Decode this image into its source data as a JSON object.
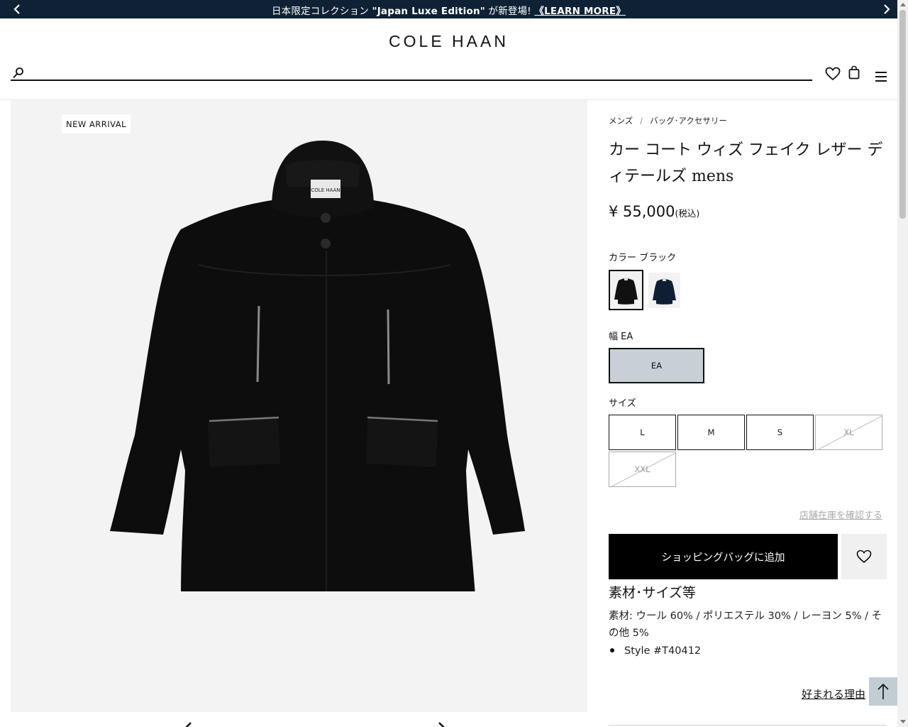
{
  "promo": {
    "text_prefix": "日本限定コレクション ",
    "text_highlight": "\"Japan Luxe Edition\"",
    "text_suffix": " が新登場! ",
    "link_label": "《LEARN MORE》"
  },
  "header": {
    "logo": "COLE HAAN",
    "search_placeholder": "",
    "icons": [
      "search-icon",
      "heart-icon",
      "bag-icon",
      "menu-icon"
    ]
  },
  "gallery": {
    "badge": "NEW ARRIVAL",
    "image": "black-coat"
  },
  "product": {
    "breadcrumb": [
      "メンズ",
      "バッグ･アクセサリー"
    ],
    "breadcrumb_sep": "/",
    "title": "カー コート ウィズ フェイク レザー ディテールズ mens",
    "price": "¥ 55,000",
    "tax_note": "(税込)",
    "color_label": "カラー ブラック",
    "width_label": "幅 EA",
    "width_option": "EA",
    "size_label": "サイズ",
    "sizes": [
      {
        "label": "L",
        "available": true
      },
      {
        "label": "M",
        "available": true
      },
      {
        "label": "S",
        "available": true
      },
      {
        "label": "XL",
        "available": false
      },
      {
        "label": "XXL",
        "available": false
      }
    ],
    "store_stock_link": "店舗在庫を確認する",
    "add_to_bag": "ショッピングバッグに追加",
    "materials_title": "素材･サイズ等",
    "materials_text": "素材: ウール 60% / ポリエステル 30% / レーヨン 5% / その他 5%",
    "style_item": "Style #T40412",
    "reason_link": "好まれる理由"
  },
  "colors": {
    "promo_bg": "#0f2235",
    "width_selected_bg": "#c6d0d6",
    "to_top_bg": "#c2ccd3"
  }
}
